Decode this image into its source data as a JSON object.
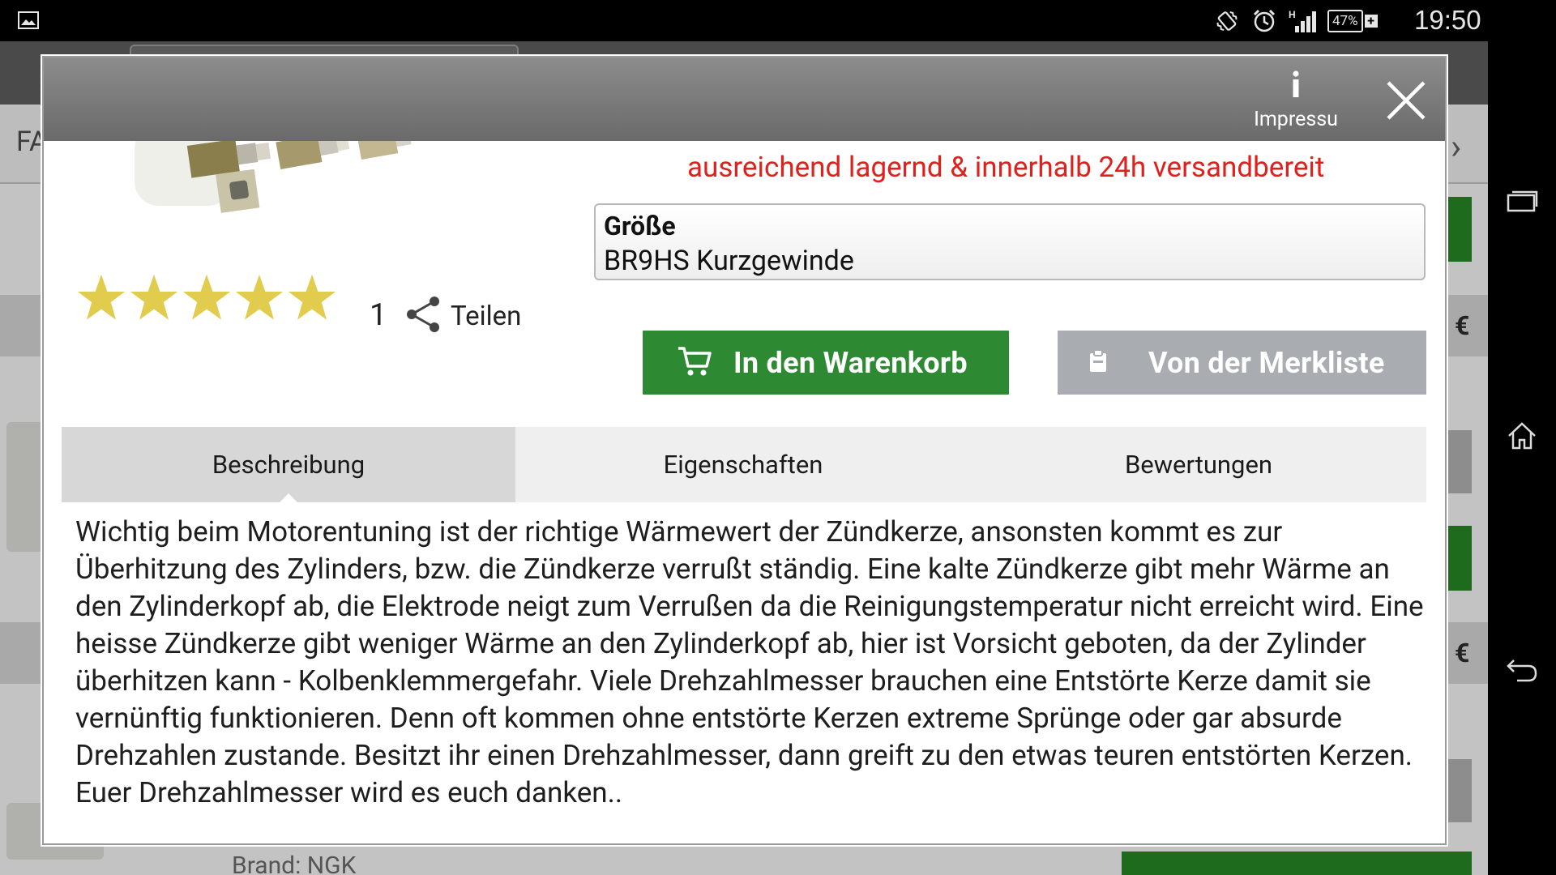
{
  "status_bar": {
    "battery": "47%",
    "time": "19:50",
    "network": "H"
  },
  "background_page": {
    "tab_label": "FA",
    "brand_text": "Brand: NGK",
    "euro_symbol": "€"
  },
  "header": {
    "impressum_label": "Impressu"
  },
  "product": {
    "stock_status": "ausreichend lagernd & innerhalb 24h versandbereit",
    "size_label": "Größe",
    "size_value": "BR9HS Kurzgewinde",
    "rating_stars": 5,
    "rating_count": "1",
    "share_label": "Teilen",
    "add_to_cart_label": "In den Warenkorb",
    "wishlist_label": "Von der Merkliste"
  },
  "tabs": [
    {
      "label": "Beschreibung",
      "active": true
    },
    {
      "label": "Eigenschaften",
      "active": false
    },
    {
      "label": "Bewertungen",
      "active": false
    }
  ],
  "description": "Wichtig beim Motorentuning ist der richtige Wärmewert der Zündkerze, ansonsten kommt es zur Überhitzung des Zylinders, bzw. die Zündkerze verrußt ständig. Eine kalte Zündkerze gibt mehr Wärme an den Zylinderkopf ab, die Elektrode neigt zum Verrußen da die Reinigungstemperatur nicht erreicht wird. Eine heisse Zündkerze gibt weniger Wärme an den Zylinderkopf ab, hier ist Vorsicht geboten, da der Zylinder überhitzen kann - Kolbenklemmergefahr. Viele Drehzahlmesser brauchen eine Entstörte Kerze damit sie vernünftig funktionieren. Denn oft kommen ohne entstörte Kerzen extreme Sprünge oder gar absurde Drehzahlen zustande. Besitzt ihr einen Drehzahlmesser, dann greift zu den etwas teuren entstörten Kerzen. Euer Drehzahlmesser wird es euch danken..",
  "colors": {
    "stock_red": "#e0201c",
    "cart_green": "#2e8a32",
    "wishlist_grey": "#a9acb0",
    "header_grey": "#7a7a7a",
    "star_gold": "#e2cc4e"
  },
  "icons": {
    "gallery": "gallery-icon",
    "vibrate": "vibrate-icon",
    "alarm": "alarm-icon",
    "signal": "signal-icon",
    "battery": "battery-icon",
    "info": "info-icon",
    "close": "close-icon",
    "share": "share-icon",
    "cart": "cart-icon",
    "clipboard": "clipboard-icon",
    "recent_apps": "recent-apps-icon",
    "home": "home-icon",
    "back": "back-icon"
  }
}
